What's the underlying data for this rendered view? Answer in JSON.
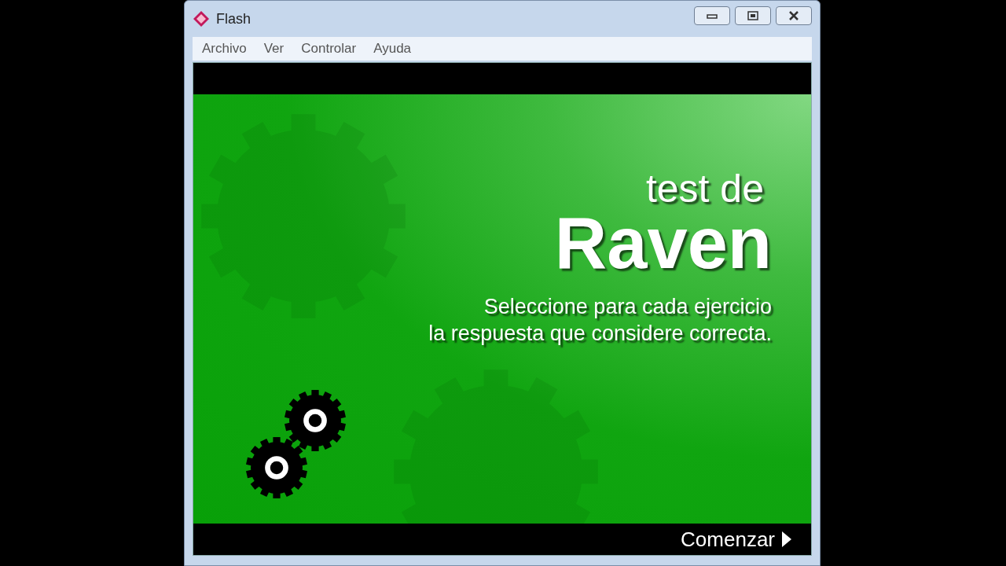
{
  "window": {
    "title": "Flash"
  },
  "menu": [
    "Archivo",
    "Ver",
    "Controlar",
    "Ayuda"
  ],
  "content": {
    "heading_small": "test de",
    "heading_large": "Raven",
    "instructions": [
      "Seleccione para cada ejercicio",
      "la respuesta que considere correcta."
    ],
    "start_button": "Comenzar"
  }
}
